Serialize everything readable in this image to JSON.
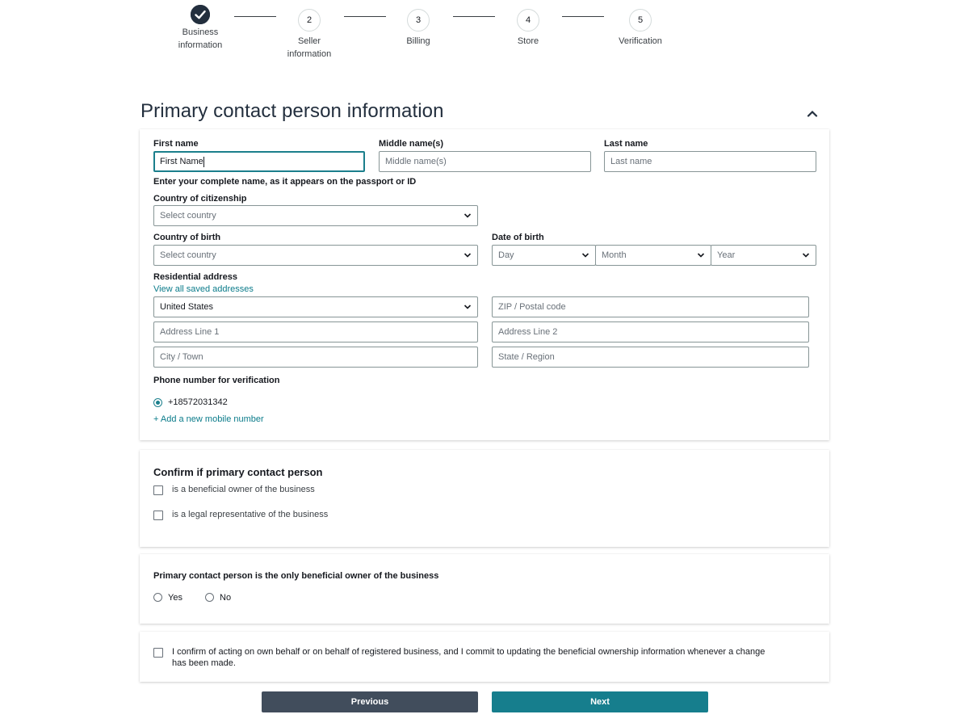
{
  "stepper": {
    "steps": [
      {
        "number": "",
        "label_line1": "Business",
        "label_line2": "information",
        "status": "completed"
      },
      {
        "number": "2",
        "label_line1": "Seller",
        "label_line2": "information",
        "status": "current"
      },
      {
        "number": "3",
        "label_line1": "Billing",
        "label_line2": "",
        "status": "upcoming"
      },
      {
        "number": "4",
        "label_line1": "Store",
        "label_line2": "",
        "status": "upcoming"
      },
      {
        "number": "5",
        "label_line1": "Verification",
        "label_line2": "",
        "status": "upcoming"
      }
    ]
  },
  "section": {
    "title": "Primary contact person information",
    "collapse_icon": "chevron-up-icon"
  },
  "contact_form": {
    "first_name": {
      "label": "First name",
      "value": "First Name",
      "placeholder": "First Name"
    },
    "middle_name": {
      "label": "Middle name(s)",
      "value": "",
      "placeholder": "Middle name(s)"
    },
    "last_name": {
      "label": "Last name",
      "value": "",
      "placeholder": "Last name"
    },
    "name_hint": "Enter your complete name, as it appears on the passport or ID",
    "citizenship": {
      "label": "Country of citizenship",
      "selected": "Select country"
    },
    "birth_country": {
      "label": "Country of birth",
      "selected": "Select country"
    },
    "dob": {
      "label": "Date of birth",
      "day": "Day",
      "month": "Month",
      "year": "Year"
    },
    "address": {
      "label": "Residential address",
      "saved_link": "View all saved addresses",
      "country": "United States",
      "zip_placeholder": "ZIP / Postal code",
      "line1_placeholder": "Address Line 1",
      "line2_placeholder": "Address Line 2",
      "city_placeholder": "City / Town",
      "state_placeholder": "State / Region"
    },
    "phone": {
      "label": "Phone number for verification",
      "number": "+18572031342",
      "selected": true,
      "add_link": "+ Add a new mobile number"
    }
  },
  "confirm_card": {
    "heading": "Confirm if primary contact person",
    "options": [
      {
        "label": "is a beneficial owner of the business",
        "checked": false
      },
      {
        "label": "is a legal representative of the business",
        "checked": false
      }
    ]
  },
  "owner_card": {
    "question": "Primary contact person is the only beneficial owner of the business",
    "options": [
      {
        "label": "Yes",
        "selected": false
      },
      {
        "label": "No",
        "selected": false
      }
    ]
  },
  "declaration": {
    "line1": "I confirm of acting on own behalf or on behalf of registered business, and I commit to updating the beneficial ownership information whenever a change",
    "line2": "has been made.",
    "checked": false
  },
  "actions": {
    "previous": "Previous",
    "next": "Next"
  },
  "colors": {
    "primary": "#167e8d",
    "secondary": "#414d5c",
    "completed_step": "#232f3e",
    "link": "#0a7b8a"
  }
}
